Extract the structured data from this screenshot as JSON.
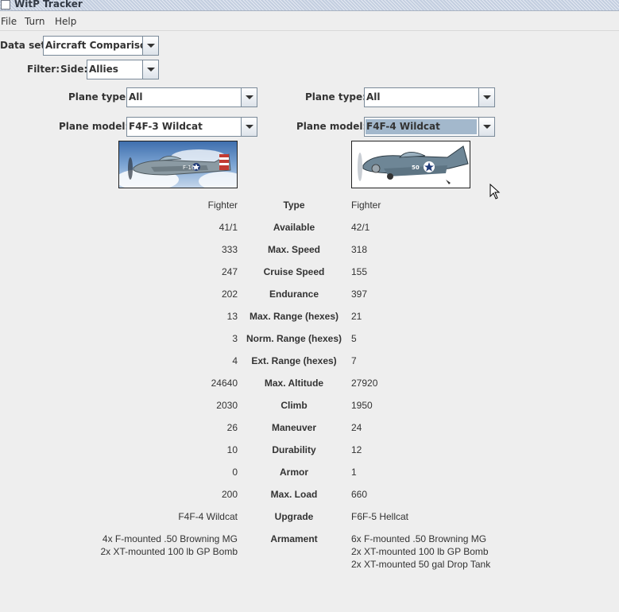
{
  "window": {
    "title": "WitP Tracker"
  },
  "menu": [
    {
      "label": "File"
    },
    {
      "label": "Turn"
    },
    {
      "label": "Help"
    }
  ],
  "dataset": {
    "label": "Data set:",
    "value": "Aircraft Comparison"
  },
  "filter": {
    "label": "Filter:",
    "side_label": "Side:",
    "side_value": "Allies"
  },
  "left": {
    "plane_type_label": "Plane type:",
    "plane_type_value": "All",
    "plane_model_label": "Plane model:",
    "plane_model_value": "F4F-3 Wildcat"
  },
  "right": {
    "plane_type_label": "Plane type:",
    "plane_type_value": "All",
    "plane_model_label": "Plane model:",
    "plane_model_value": "F4F-4 Wildcat"
  },
  "rows": [
    {
      "label": "Type",
      "left": [
        "Fighter"
      ],
      "right": [
        "Fighter"
      ]
    },
    {
      "label": "Available",
      "left": [
        "41/1"
      ],
      "right": [
        "42/1"
      ]
    },
    {
      "label": "Max. Speed",
      "left": [
        "333"
      ],
      "right": [
        "318"
      ]
    },
    {
      "label": "Cruise Speed",
      "left": [
        "247"
      ],
      "right": [
        "155"
      ]
    },
    {
      "label": "Endurance",
      "left": [
        "202"
      ],
      "right": [
        "397"
      ]
    },
    {
      "label": "Max. Range (hexes)",
      "left": [
        "13"
      ],
      "right": [
        "21"
      ]
    },
    {
      "label": "Norm. Range (hexes)",
      "left": [
        "3"
      ],
      "right": [
        "5"
      ]
    },
    {
      "label": "Ext. Range (hexes)",
      "left": [
        "4"
      ],
      "right": [
        "7"
      ]
    },
    {
      "label": "Max. Altitude",
      "left": [
        "24640"
      ],
      "right": [
        "27920"
      ]
    },
    {
      "label": "Climb",
      "left": [
        "2030"
      ],
      "right": [
        "1950"
      ]
    },
    {
      "label": "Maneuver",
      "left": [
        "26"
      ],
      "right": [
        "24"
      ]
    },
    {
      "label": "Durability",
      "left": [
        "10"
      ],
      "right": [
        "12"
      ]
    },
    {
      "label": "Armor",
      "left": [
        "0"
      ],
      "right": [
        "1"
      ]
    },
    {
      "label": "Max. Load",
      "left": [
        "200"
      ],
      "right": [
        "660"
      ]
    },
    {
      "label": "Upgrade",
      "left": [
        "F4F-4 Wildcat"
      ],
      "right": [
        "F6F-5 Hellcat"
      ]
    },
    {
      "label": "Armament",
      "left": [
        "4x F-mounted .50 Browning MG",
        "2x XT-mounted 100 lb GP Bomb"
      ],
      "right": [
        "6x F-mounted .50 Browning MG",
        "2x XT-mounted 100 lb GP Bomb",
        "2x XT-mounted 50 gal Drop Tank"
      ]
    }
  ],
  "images": {
    "left_insignia": "F-16",
    "right_insignia": "50"
  },
  "colors": {
    "titlebar": "#c3cee0",
    "selection": "#a3b8cc",
    "background": "#eeeeee"
  }
}
